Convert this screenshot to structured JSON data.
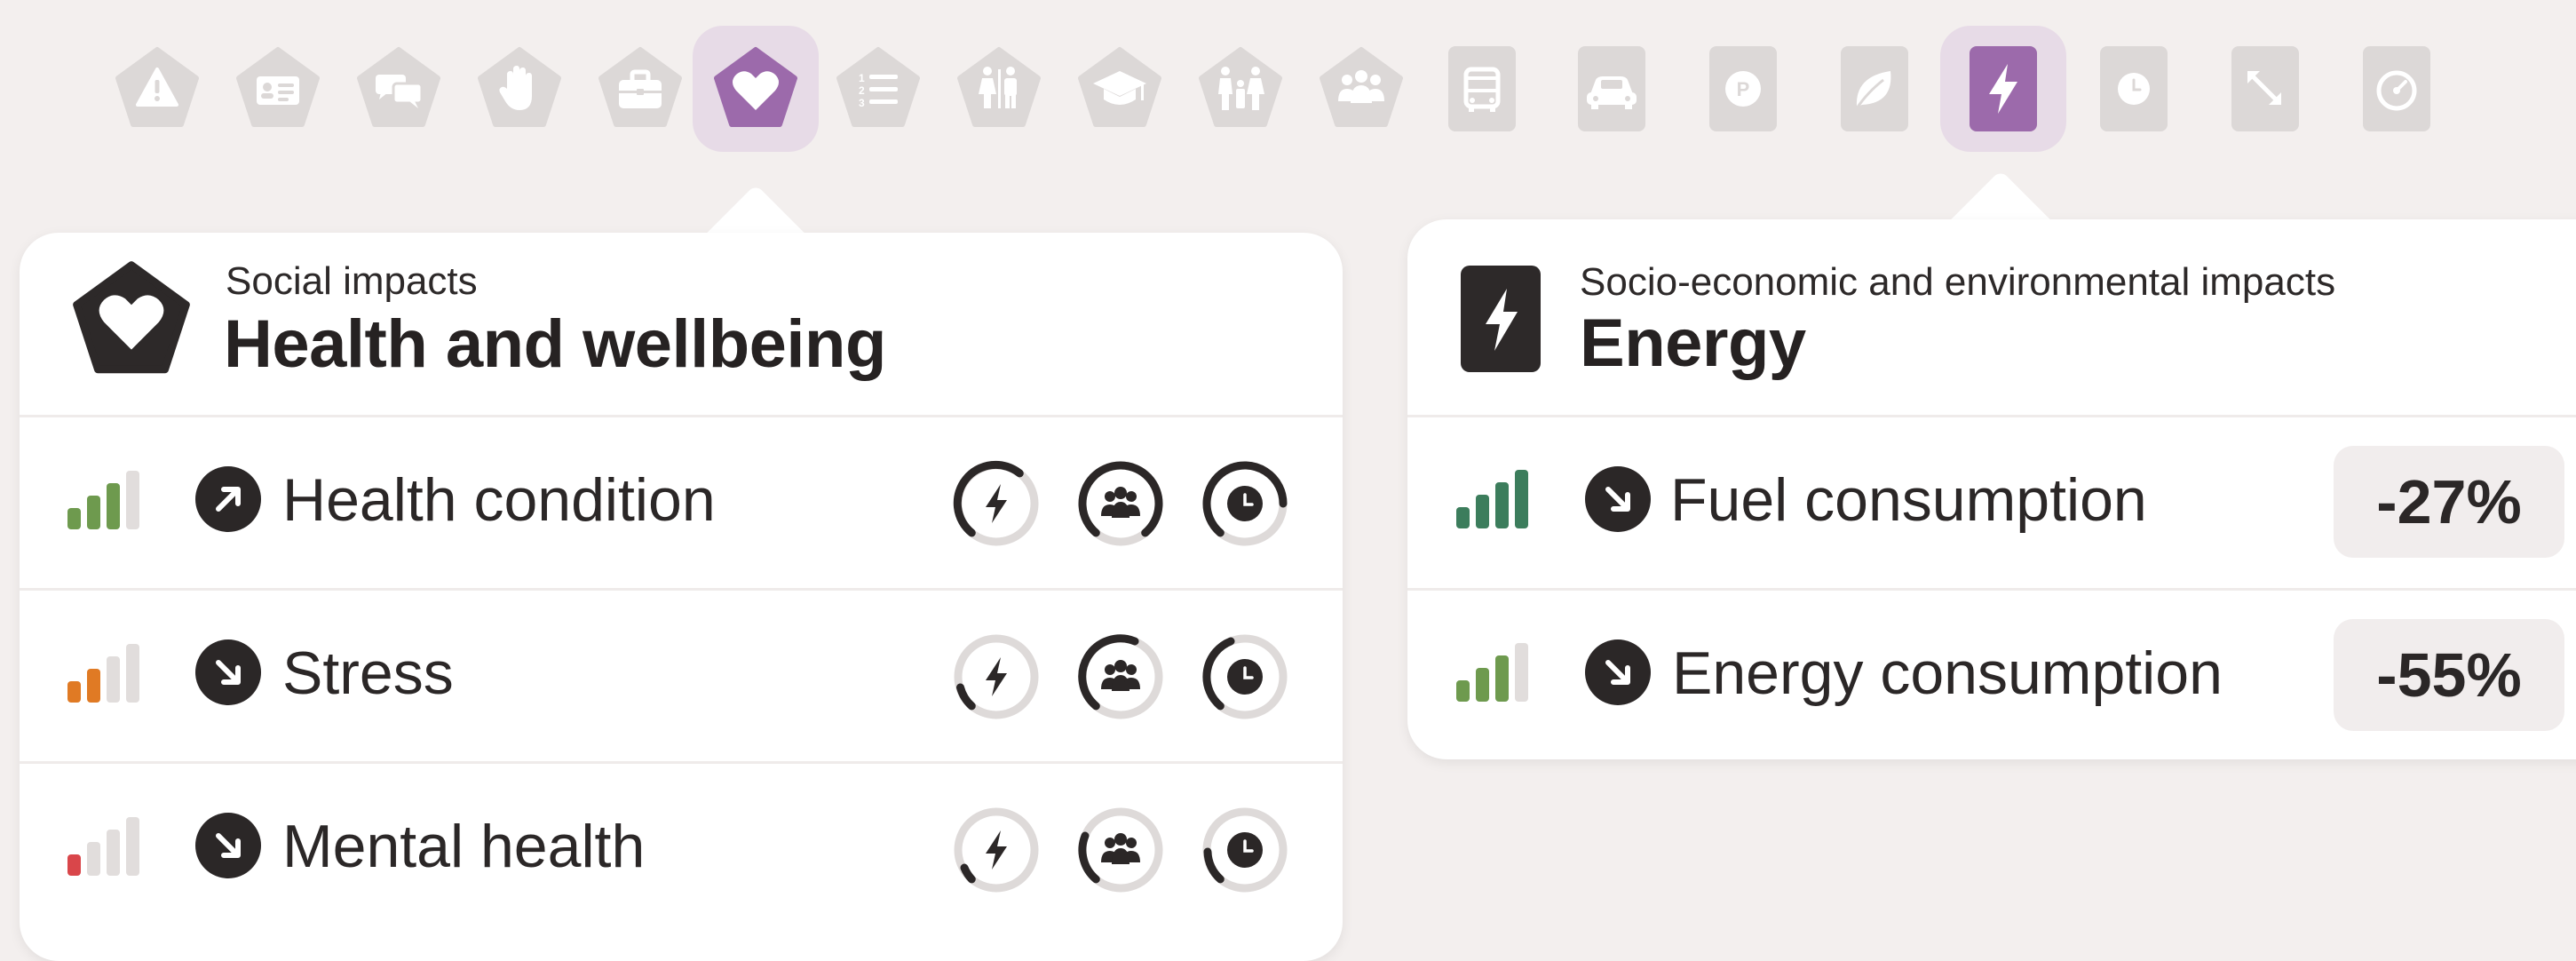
{
  "toolbar": {
    "selected_color": "#9c6aab",
    "inactive_color": "#dcd8d7",
    "selected_items": [
      "heart-icon",
      "lightning-bolt-icon"
    ],
    "social_icons": [
      "warning-icon",
      "id-card-icon",
      "chat-bubbles-icon",
      "raised-hand-icon",
      "briefcase-icon",
      "heart-icon",
      "numbered-list-icon",
      "restroom-icon",
      "graduation-cap-icon",
      "family-icon",
      "group-icon"
    ],
    "environmental_icons": [
      "bus-icon",
      "car-icon",
      "parking-icon",
      "leaf-icon",
      "lightning-bolt-icon",
      "clock-icon",
      "expand-arrows-icon",
      "speedometer-icon"
    ]
  },
  "health_card": {
    "category": "Social impacts",
    "title": "Health and wellbeing",
    "icon": "heart-icon",
    "rows": [
      {
        "label": "Health condition",
        "bars_active": 3,
        "bar_color": "#6e9a4e",
        "trend": "up",
        "gauges": [
          0.45,
          0.95,
          0.8
        ]
      },
      {
        "label": "Stress",
        "bars_active": 2,
        "bar_color": "#e07a24",
        "trend": "down",
        "gauges": [
          0.2,
          0.6,
          0.45
        ]
      },
      {
        "label": "Mental health",
        "bars_active": 1,
        "bar_color": "#d9464a",
        "trend": "down",
        "gauges": [
          0.12,
          0.35,
          0.25
        ]
      }
    ],
    "gauge_icons": [
      "lightning-bolt-icon",
      "group-icon",
      "clock-icon"
    ]
  },
  "energy_card": {
    "category": "Socio-economic and environmental impacts",
    "title": "Energy",
    "icon": "lightning-bolt-icon",
    "rows": [
      {
        "label": "Fuel consumption",
        "value": "-27%",
        "bars_active": 4,
        "bar_color": "#3c7d5c",
        "trend": "down"
      },
      {
        "label": "Energy consumption",
        "value": "-55%",
        "bars_active": 3,
        "bar_color": "#6e9a4e",
        "trend": "down"
      }
    ]
  },
  "colors": {
    "bar_inactive": "#e1dddc",
    "gauge_track": "#dedad9",
    "ink": "#2b2727"
  }
}
